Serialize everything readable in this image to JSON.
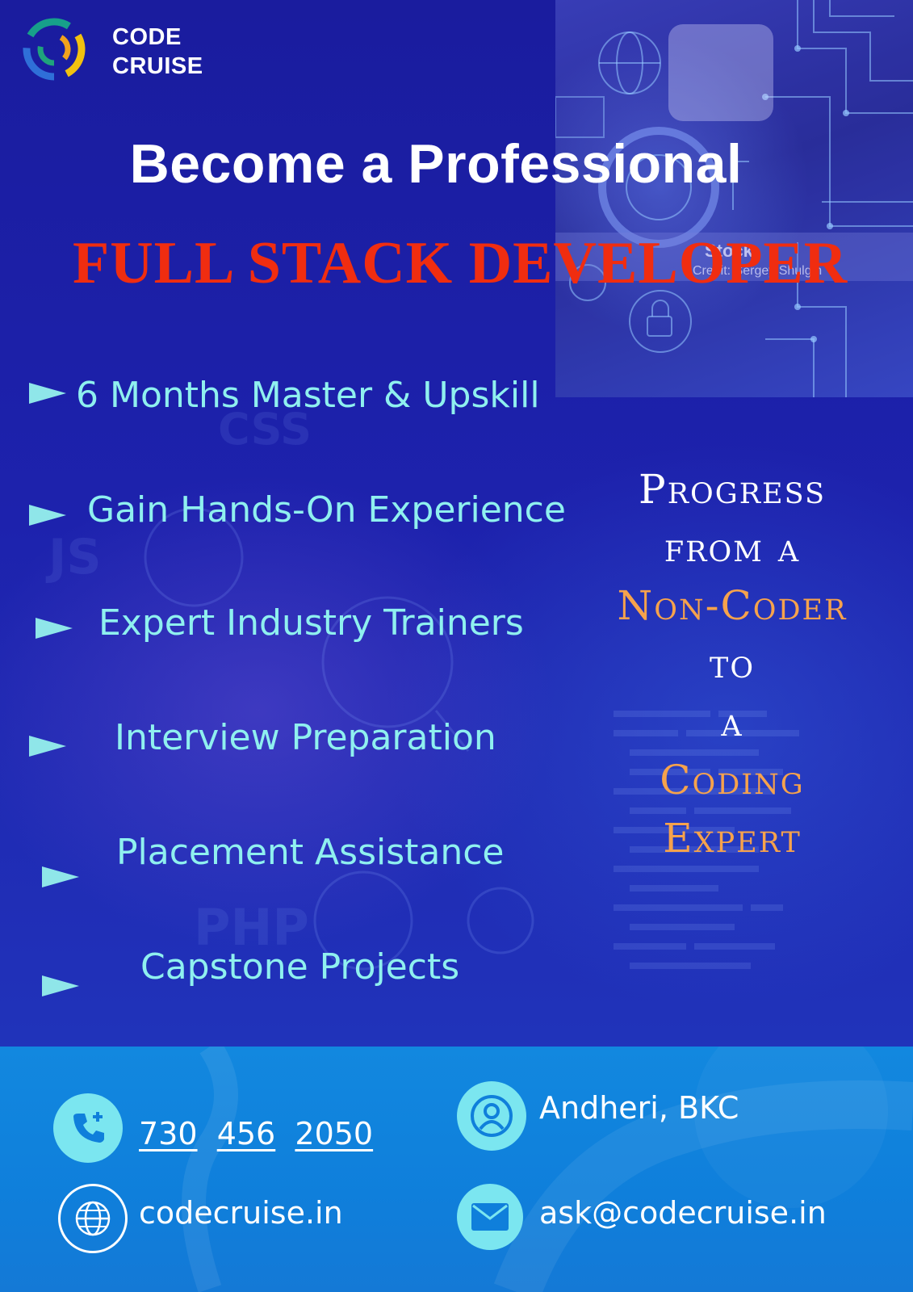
{
  "brand": {
    "line1": "CODE",
    "line2": "CRUISE"
  },
  "headline": "Become a Professional",
  "subheadline": "FULL STACK DEVELOPER",
  "features": [
    "6 Months Master & Upskill",
    "Gain Hands-On Experience",
    "Expert Industry Trainers",
    "Interview Preparation",
    "Placement Assistance",
    "Capstone Projects"
  ],
  "tagline": {
    "line1": "Progress",
    "line2": "from a",
    "line3": "Non-Coder",
    "line4": "to",
    "line5": "a",
    "line6": "Coding",
    "line7": "Expert"
  },
  "contact": {
    "phone_parts": [
      "730",
      "456",
      "2050"
    ],
    "location": "Andheri, BKC",
    "website": "codecruise.in",
    "email": "ask@codecruise.in"
  },
  "background_text": [
    "JS",
    "PHP",
    "CSS",
    "Stock",
    "Credit: Sergey Shulgin"
  ],
  "colors": {
    "background": "#1b1fa8",
    "feature_text": "#8ff0ef",
    "subheadline": "#f02d10",
    "tagline_accent": "#f6a24c",
    "footer": "#1288df",
    "icon_circle": "#7be6f0"
  },
  "icons": [
    "logo-ring-icon",
    "triangle-bullet-icon",
    "phone-plus-icon",
    "user-pin-icon",
    "globe-icon",
    "mail-icon"
  ]
}
